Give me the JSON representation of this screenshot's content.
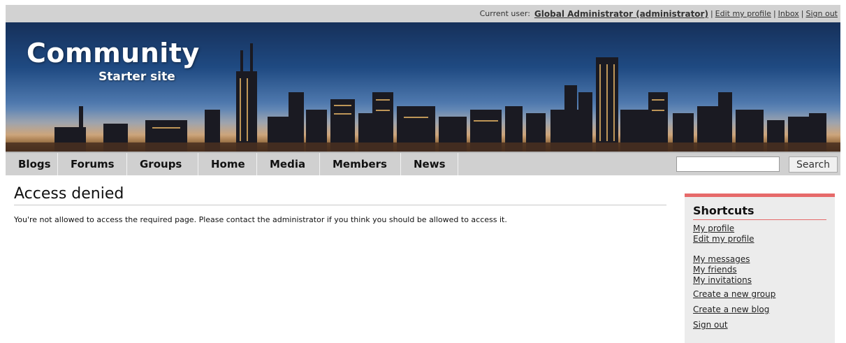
{
  "topbar": {
    "label": "Current user:",
    "user": "Global Administrator (administrator)",
    "links": [
      "Edit my profile",
      "Inbox",
      "Sign out"
    ],
    "separator": "|"
  },
  "banner": {
    "title": "Community",
    "subtitle": "Starter site"
  },
  "nav": {
    "items": [
      "Blogs",
      "Forums",
      "Groups",
      "Home",
      "Media",
      "Members",
      "News"
    ]
  },
  "search": {
    "value": "",
    "button": "Search"
  },
  "main": {
    "title": "Access denied",
    "message": "You're not allowed to access the required page. Please contact the administrator if you think you should be allowed to access it."
  },
  "shortcuts": {
    "title": "Shortcuts",
    "links": [
      "My profile",
      "Edit my profile",
      "My messages",
      "My friends",
      "My invitations",
      "Create a new group",
      "Create a new blog",
      "Sign out"
    ]
  },
  "colors": {
    "accent": "#e66a6a",
    "nav_bg": "#d0d0d0",
    "topbar_bg": "#d2d2d2",
    "shortcuts_bg": "#ececec"
  }
}
